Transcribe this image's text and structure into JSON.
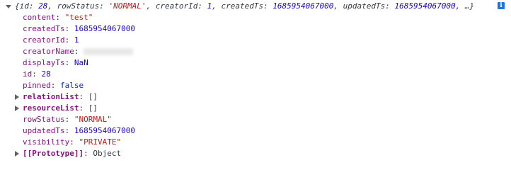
{
  "summary": {
    "open": "{",
    "items": [
      {
        "key": "id",
        "value": "28",
        "type": "num"
      },
      {
        "key": "rowStatus",
        "value": "'NORMAL'",
        "type": "str"
      },
      {
        "key": "creatorId",
        "value": "1",
        "type": "num"
      },
      {
        "key": "createdTs",
        "value": "1685954067000",
        "type": "num"
      },
      {
        "key": "updatedTs",
        "value": "1685954067000",
        "type": "num"
      }
    ],
    "ellipsis": "…}"
  },
  "properties": [
    {
      "key": "content",
      "value": "\"test\"",
      "type": "str",
      "expandable": false
    },
    {
      "key": "createdTs",
      "value": "1685954067000",
      "type": "num",
      "expandable": false
    },
    {
      "key": "creatorId",
      "value": "1",
      "type": "num",
      "expandable": false
    },
    {
      "key": "creatorName",
      "value": "",
      "type": "redacted",
      "expandable": false
    },
    {
      "key": "displayTs",
      "value": "NaN",
      "type": "num",
      "expandable": false
    },
    {
      "key": "id",
      "value": "28",
      "type": "num",
      "expandable": false
    },
    {
      "key": "pinned",
      "value": "false",
      "type": "bool",
      "expandable": false
    },
    {
      "key": "relationList",
      "value": "[]",
      "type": "plain",
      "expandable": true
    },
    {
      "key": "resourceList",
      "value": "[]",
      "type": "plain",
      "expandable": true
    },
    {
      "key": "rowStatus",
      "value": "\"NORMAL\"",
      "type": "str",
      "expandable": false
    },
    {
      "key": "updatedTs",
      "value": "1685954067000",
      "type": "num",
      "expandable": false
    },
    {
      "key": "visibility",
      "value": "\"PRIVATE\"",
      "type": "str",
      "expandable": false
    },
    {
      "key": "[[Prototype]]",
      "value": "Object",
      "type": "plain",
      "expandable": true
    }
  ],
  "info_icon": "i"
}
